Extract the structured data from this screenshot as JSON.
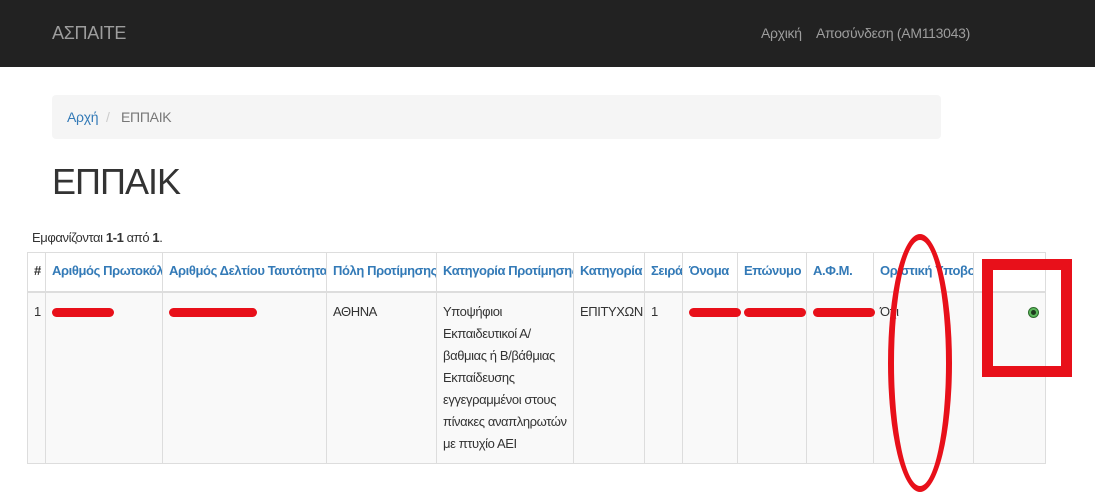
{
  "navbar": {
    "brand": "ΑΣΠΑΙΤΕ",
    "home_link": "Αρχική",
    "logout_link": "Αποσύνδεση (ΑΜ113043)"
  },
  "breadcrumb": {
    "home": "Αρχή",
    "separator": "/",
    "current": "ΕΠΠΑΙΚ"
  },
  "page": {
    "title": "ΕΠΠΑΙΚ",
    "summary_prefix": "Εμφανίζονται ",
    "summary_range": "1-1",
    "summary_middle": " από ",
    "summary_total": "1",
    "summary_suffix": "."
  },
  "table": {
    "headers": [
      "#",
      "Αριθμός Πρωτοκόλλου",
      "Αριθμός Δελτίου Ταυτότητας",
      "Πόλη Προτίμησης",
      "Κατηγορία Προτίμησης",
      "Κατηγορία",
      "Σειρά",
      "Όνομα",
      "Επώνυμο",
      "Α.Φ.Μ.",
      "Οριστική Υποβολή",
      ""
    ],
    "rows": [
      {
        "index": "1",
        "city": "ΑΘΗΝΑ",
        "preference_category": "Υποψήφιοι Εκπαιδευτικοί Α/βαθμιας ή Β/βάθμιας Εκπαίδευσης εγγεγραμμένοι στους πίνακες αναπληρωτών με πτυχίο ΑΕΙ",
        "category": "ΕΠΙΤΥΧΩΝ",
        "order": "1",
        "final_submission": "Όχι"
      }
    ]
  },
  "colors": {
    "navbar_bg": "#222222",
    "link": "#337ab7",
    "annotation_red": "#e8101a",
    "view_icon": "#5cb85c"
  },
  "icons": {
    "row_action": "eye-icon"
  }
}
